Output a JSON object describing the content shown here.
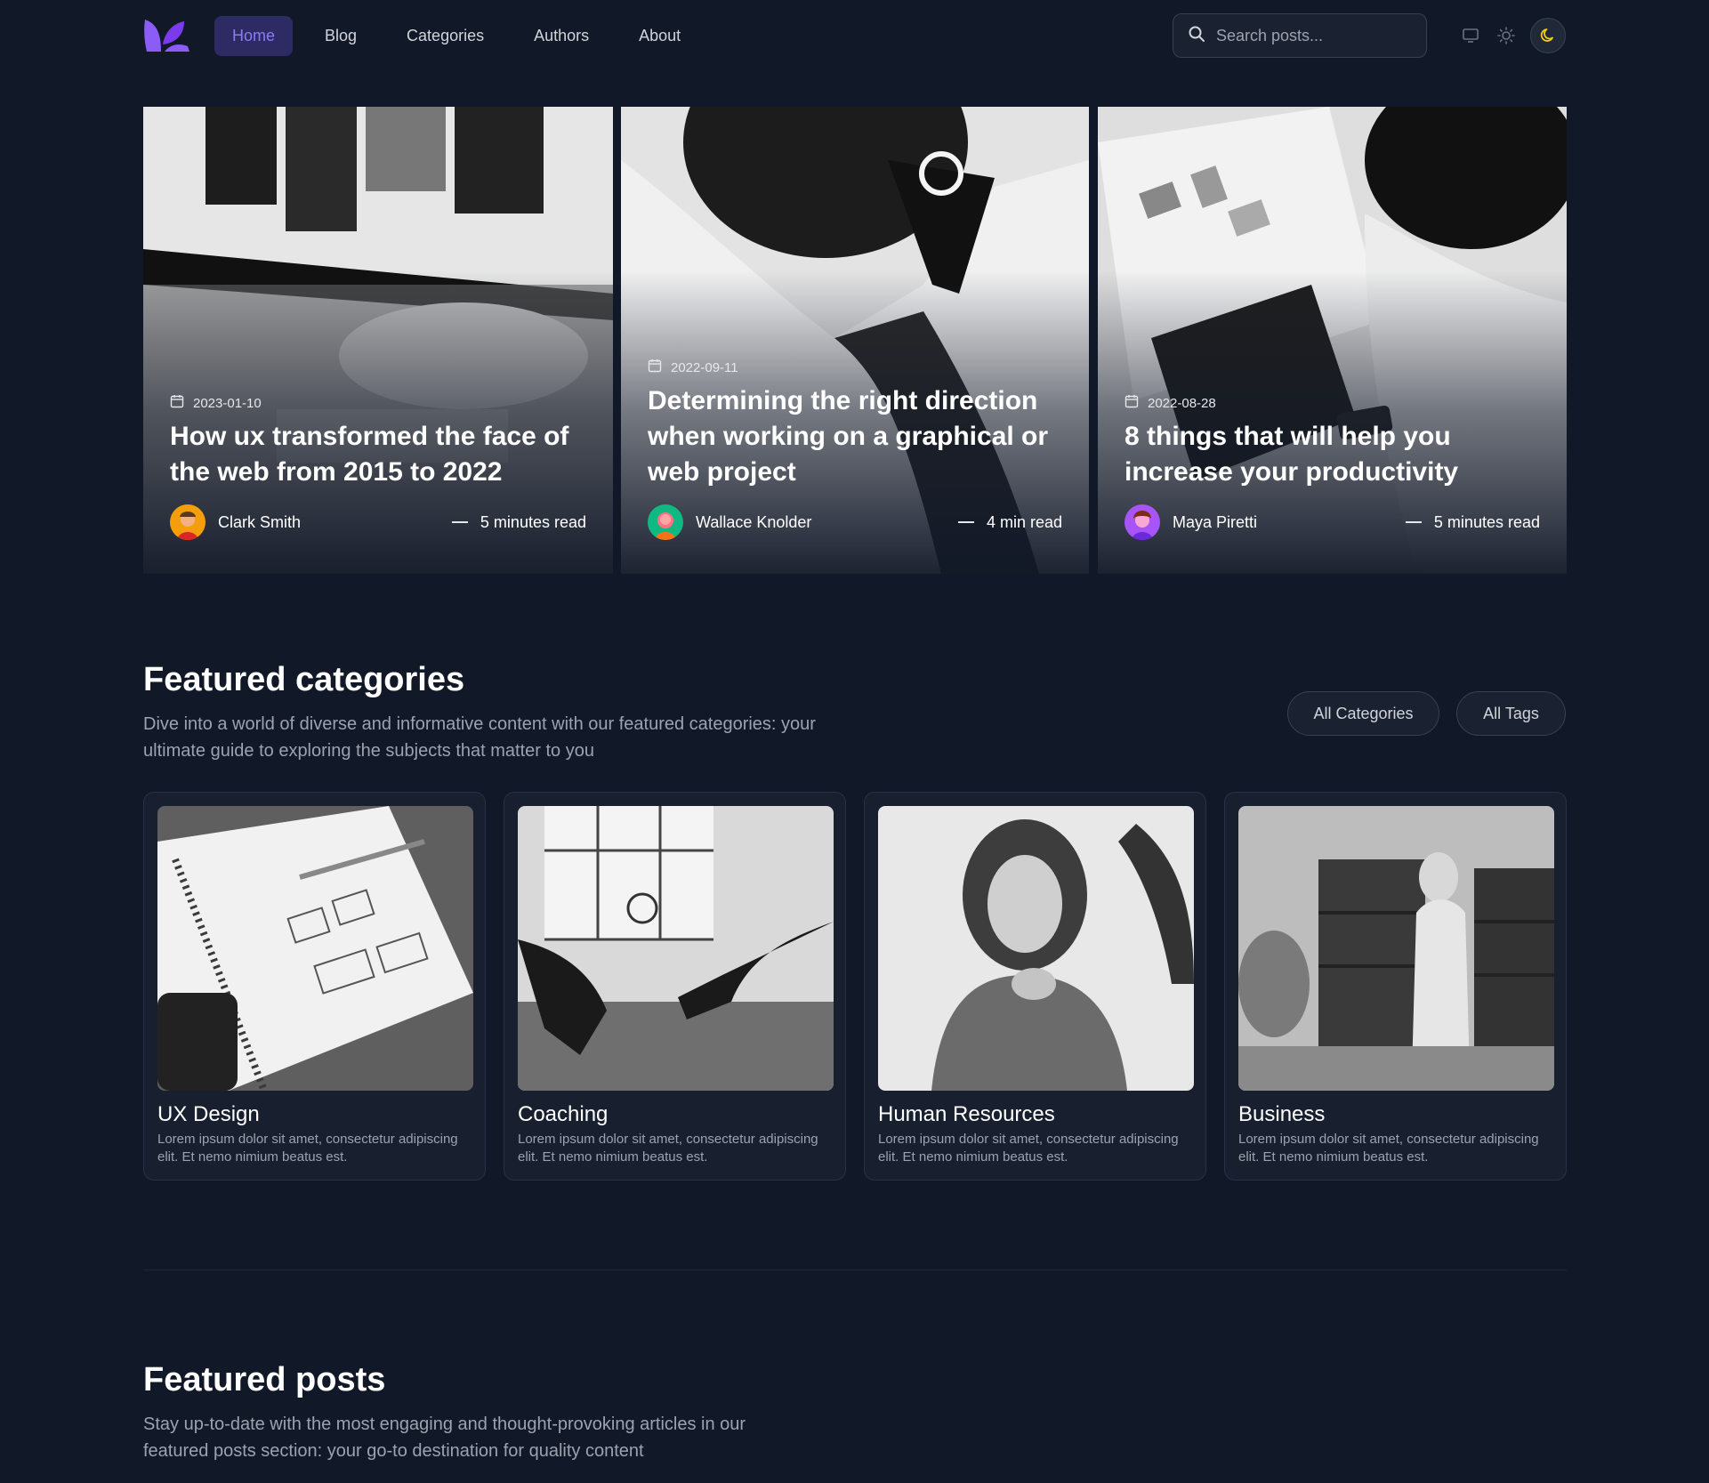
{
  "nav": {
    "logo_icon": "leaf-logo",
    "items": [
      {
        "label": "Home",
        "active": true
      },
      {
        "label": "Blog"
      },
      {
        "label": "Categories"
      },
      {
        "label": "Authors"
      },
      {
        "label": "About"
      }
    ],
    "search_placeholder": "Search posts...",
    "theme_modes": [
      "monitor-icon",
      "sun-icon",
      "moon-icon"
    ],
    "active_theme": "moon-icon"
  },
  "hero": [
    {
      "date": "2023-01-10",
      "title": "How ux transformed the face of the web from 2015 to 2022",
      "author": "Clark Smith",
      "read_time": "5 minutes read"
    },
    {
      "date": "2022-09-11",
      "title": "Determining the right direction when working on a graphical or web project",
      "author": "Wallace Knolder",
      "read_time": "4 min read"
    },
    {
      "date": "2022-08-28",
      "title": "8 things that will help you increase your productivity",
      "author": "Maya Piretti",
      "read_time": "5 minutes read"
    }
  ],
  "featured_categories": {
    "title": "Featured categories",
    "description": "Dive into a world of diverse and informative content with our featured categories: your ultimate guide to exploring the subjects that matter to you",
    "all_categories_label": "All Categories",
    "all_tags_label": "All Tags",
    "items": [
      {
        "name": "UX Design",
        "description": "Lorem ipsum dolor sit amet, consectetur adipiscing elit. Et nemo nimium beatus est."
      },
      {
        "name": "Coaching",
        "description": "Lorem ipsum dolor sit amet, consectetur adipiscing elit. Et nemo nimium beatus est."
      },
      {
        "name": "Human Resources",
        "description": "Lorem ipsum dolor sit amet, consectetur adipiscing elit. Et nemo nimium beatus est."
      },
      {
        "name": "Business",
        "description": "Lorem ipsum dolor sit amet, consectetur adipiscing elit. Et nemo nimium beatus est."
      }
    ]
  },
  "featured_posts": {
    "title": "Featured posts",
    "description": "Stay up-to-date with the most engaging and thought-provoking articles in our featured posts section: your go-to destination for quality content"
  },
  "colors": {
    "background": "#111827",
    "accent": "#8b5cf6",
    "nav_active_bg": "#2e2a63",
    "moon": "#facc15"
  }
}
